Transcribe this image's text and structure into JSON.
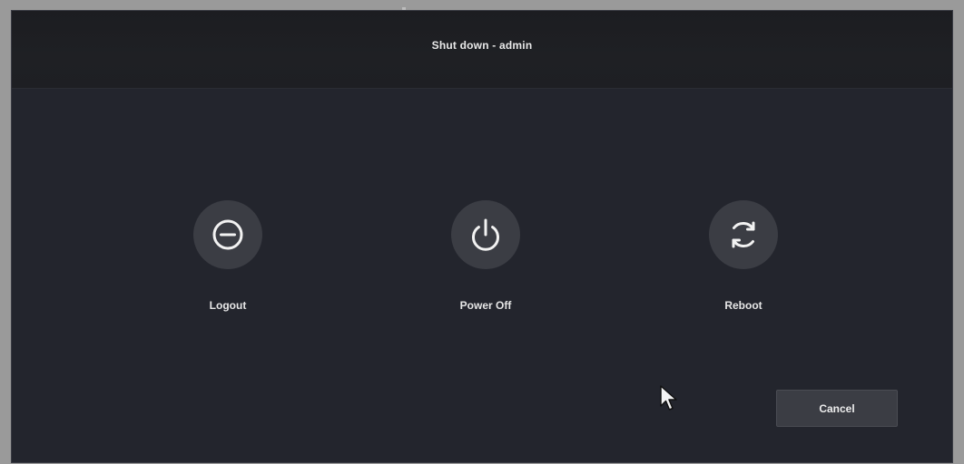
{
  "dialog": {
    "title": "Shut down - admin"
  },
  "actions": [
    {
      "label": "Logout",
      "icon": "logout-icon"
    },
    {
      "label": "Power Off",
      "icon": "power-icon"
    },
    {
      "label": "Reboot",
      "icon": "reboot-icon"
    }
  ],
  "footer": {
    "cancel_label": "Cancel"
  },
  "colors": {
    "dialog_background": "#23252d",
    "title_bar_background": "#1e1f23",
    "button_background": "#3b3d44",
    "text": "#e6e6e6"
  }
}
